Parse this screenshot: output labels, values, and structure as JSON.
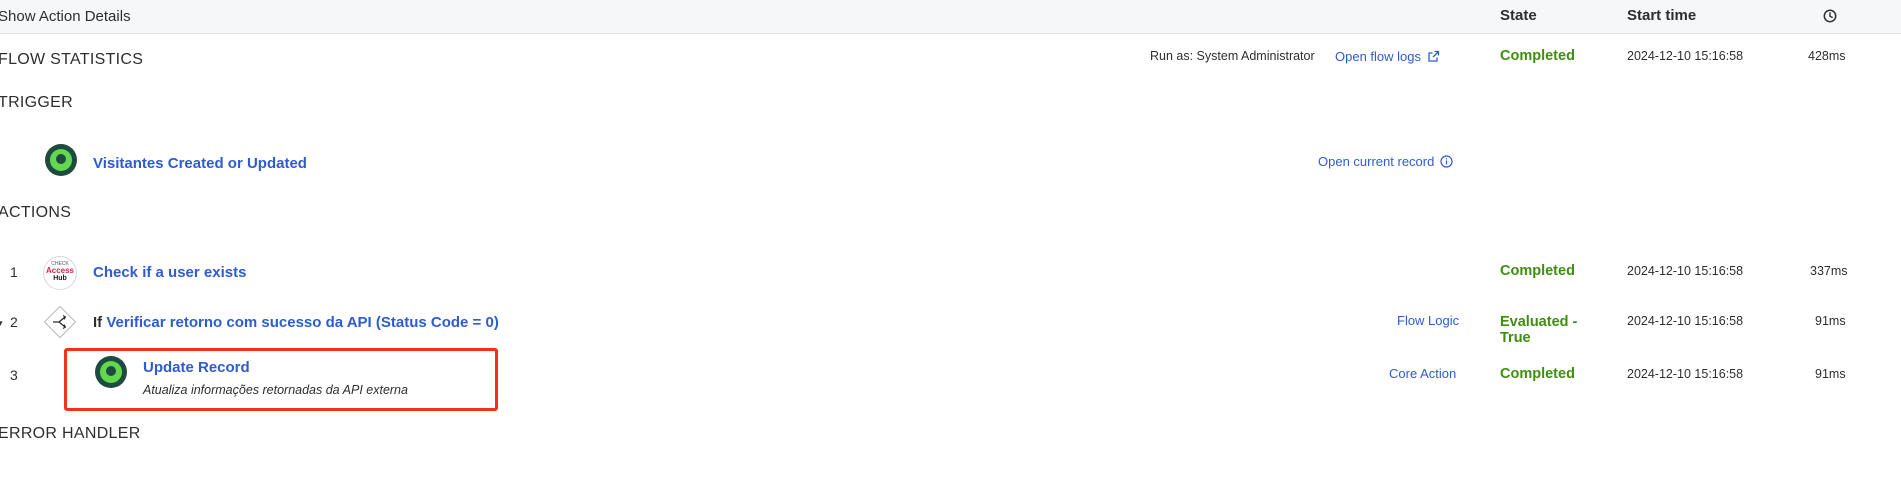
{
  "header": {
    "toggle_label": "Show Action Details",
    "col_state": "State",
    "col_start_time": "Start time",
    "duration_icon": "clock-icon"
  },
  "flow_statistics": {
    "title": "FLOW STATISTICS",
    "run_as": "Run as: System Administrator",
    "open_logs": "Open flow logs",
    "external_icon": "external-link-icon",
    "state": "Completed",
    "start_time": "2024-12-10 15:16:58",
    "duration": "428ms"
  },
  "trigger": {
    "title": "TRIGGER",
    "name": "Visitantes Created or Updated",
    "open_record": "Open current record",
    "info_icon": "info-icon"
  },
  "actions": {
    "title": "ACTIONS",
    "rows": [
      {
        "index": "1",
        "name": "Check if a user exists",
        "logo_line1": "CHECK",
        "logo_line2": "Access",
        "logo_line3": "Hub",
        "state": "Completed",
        "start_time": "2024-12-10 15:16:58",
        "duration": "337ms"
      },
      {
        "index": "2",
        "prefix": "If",
        "name": "Verificar retorno com sucesso da API (Status Code = 0)",
        "type": "Flow Logic",
        "state_line1": "Evaluated -",
        "state_line2": "True",
        "start_time": "2024-12-10 15:16:58",
        "duration": "91ms"
      },
      {
        "index": "3",
        "name": "Update Record",
        "description": "Atualiza informações retornadas da API externa",
        "type": "Core Action",
        "state": "Completed",
        "start_time": "2024-12-10 15:16:58",
        "duration": "91ms"
      }
    ]
  },
  "error_handler": {
    "title": "ERROR HANDLER"
  },
  "colors": {
    "link": "#2e5ccf",
    "success": "#3e8f10",
    "highlight": "#f4301c",
    "icon_green": "#62d84e",
    "icon_dark": "#1e4a3f"
  }
}
